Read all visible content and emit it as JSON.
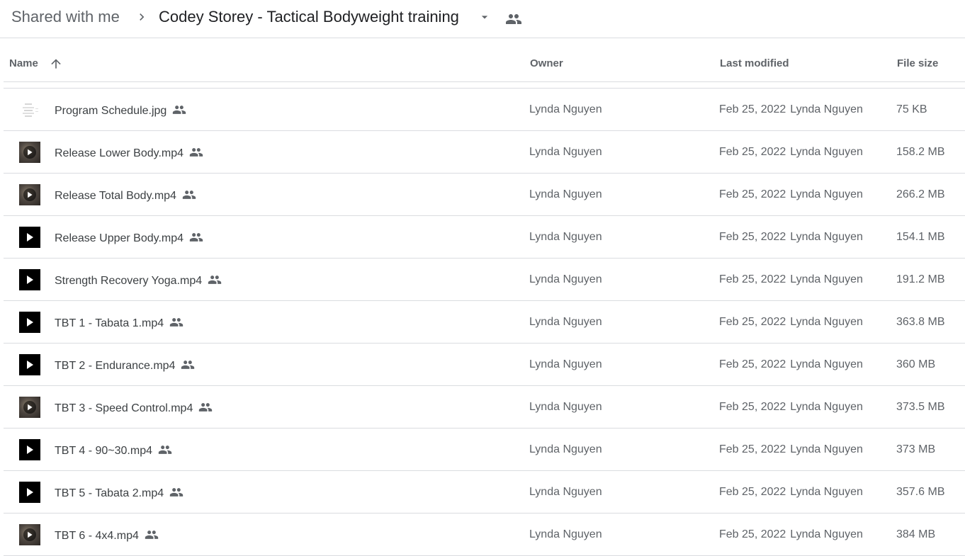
{
  "breadcrumb": {
    "root": "Shared with me",
    "current": "Codey Storey - Tactical Bodyweight training"
  },
  "columns": {
    "name": "Name",
    "owner": "Owner",
    "last_modified": "Last modified",
    "file_size": "File size"
  },
  "files": [
    {
      "name": "Program Schedule.jpg",
      "type": "image",
      "owner": "Lynda Nguyen",
      "modified": "Feb 25, 2022",
      "modified_by": "Lynda Nguyen",
      "size": "75 KB"
    },
    {
      "name": "Release Lower Body.mp4",
      "type": "video-img",
      "owner": "Lynda Nguyen",
      "modified": "Feb 25, 2022",
      "modified_by": "Lynda Nguyen",
      "size": "158.2 MB"
    },
    {
      "name": "Release Total Body.mp4",
      "type": "video-img",
      "owner": "Lynda Nguyen",
      "modified": "Feb 25, 2022",
      "modified_by": "Lynda Nguyen",
      "size": "266.2 MB"
    },
    {
      "name": "Release Upper Body.mp4",
      "type": "video",
      "owner": "Lynda Nguyen",
      "modified": "Feb 25, 2022",
      "modified_by": "Lynda Nguyen",
      "size": "154.1 MB"
    },
    {
      "name": "Strength Recovery Yoga.mp4",
      "type": "video",
      "owner": "Lynda Nguyen",
      "modified": "Feb 25, 2022",
      "modified_by": "Lynda Nguyen",
      "size": "191.2 MB"
    },
    {
      "name": "TBT 1 - Tabata 1.mp4",
      "type": "video",
      "owner": "Lynda Nguyen",
      "modified": "Feb 25, 2022",
      "modified_by": "Lynda Nguyen",
      "size": "363.8 MB"
    },
    {
      "name": "TBT 2 - Endurance.mp4",
      "type": "video",
      "owner": "Lynda Nguyen",
      "modified": "Feb 25, 2022",
      "modified_by": "Lynda Nguyen",
      "size": "360 MB"
    },
    {
      "name": "TBT 3 - Speed Control.mp4",
      "type": "video-img",
      "owner": "Lynda Nguyen",
      "modified": "Feb 25, 2022",
      "modified_by": "Lynda Nguyen",
      "size": "373.5 MB"
    },
    {
      "name": "TBT 4 - 90~30.mp4",
      "type": "video",
      "owner": "Lynda Nguyen",
      "modified": "Feb 25, 2022",
      "modified_by": "Lynda Nguyen",
      "size": "373 MB"
    },
    {
      "name": "TBT 5 - Tabata 2.mp4",
      "type": "video",
      "owner": "Lynda Nguyen",
      "modified": "Feb 25, 2022",
      "modified_by": "Lynda Nguyen",
      "size": "357.6 MB"
    },
    {
      "name": "TBT 6 - 4x4.mp4",
      "type": "video-img",
      "owner": "Lynda Nguyen",
      "modified": "Feb 25, 2022",
      "modified_by": "Lynda Nguyen",
      "size": "384 MB"
    }
  ],
  "icons": {
    "breadcrumb_separator": "chevron-right-icon",
    "folder_menu": "caret-down-icon",
    "shared": "people-icon",
    "sort": "arrow-up-icon",
    "video_thumb": "play-icon",
    "image_thumb": "image-icon"
  },
  "colors": {
    "text_primary": "#202124",
    "text_secondary": "#5f6368",
    "divider": "#dadce0"
  }
}
